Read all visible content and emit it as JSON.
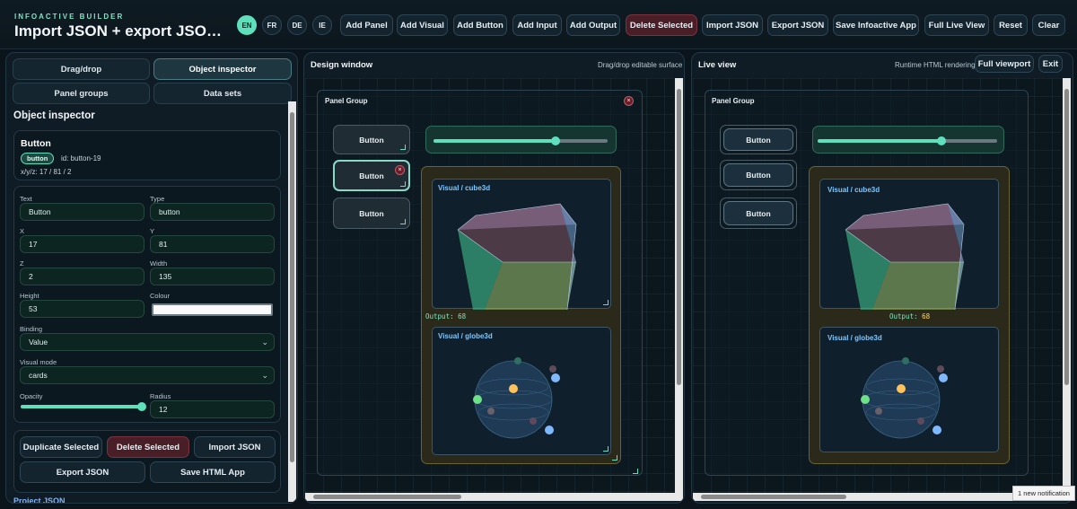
{
  "app": {
    "brand_small": "INFOACTIVE BUILDER",
    "title": "Import JSON + export JSON + save s..."
  },
  "languages": [
    "EN",
    "FR",
    "DE",
    "IE"
  ],
  "active_language": "EN",
  "toolbar": {
    "add_panel": "Add Panel",
    "add_visual": "Add Visual",
    "add_button": "Add Button",
    "add_input": "Add Input",
    "add_output": "Add Output",
    "delete_selected": "Delete Selected",
    "import_json": "Import JSON",
    "export_json": "Export JSON",
    "save_app": "Save Infoactive App",
    "full_live_view": "Full Live View",
    "reset": "Reset",
    "clear": "Clear"
  },
  "left": {
    "tabs": [
      "Drag/drop",
      "Object inspector",
      "Panel groups",
      "Data sets"
    ],
    "active_tab": "Object inspector",
    "section_title": "Object inspector",
    "selected": {
      "name": "Button",
      "type_badge": "button",
      "id_text": "id: button-19",
      "coords": "x/y/z: 17 / 81 / 2"
    },
    "fields": {
      "text_label": "Text",
      "text_value": "Button",
      "type_label": "Type",
      "type_value": "button",
      "x_label": "X",
      "x_value": "17",
      "y_label": "Y",
      "y_value": "81",
      "z_label": "Z",
      "z_value": "2",
      "width_label": "Width",
      "width_value": "135",
      "height_label": "Height",
      "height_value": "53",
      "colour_label": "Colour",
      "colour_value": "#ffffff",
      "binding_label": "Binding",
      "binding_value": "Value",
      "visual_mode_label": "Visual mode",
      "visual_mode_value": "cards",
      "opacity_label": "Opacity",
      "opacity_value": 1.0,
      "radius_label": "Radius",
      "radius_value": "12"
    },
    "actions": {
      "duplicate": "Duplicate Selected",
      "delete": "Delete Selected",
      "import": "Import JSON",
      "export": "Export JSON",
      "save_html": "Save HTML App"
    },
    "project_json_label": "Project JSON"
  },
  "design": {
    "title": "Design window",
    "subtitle": "Drag/drop editable surface",
    "group_title": "Panel Group",
    "buttons": [
      "Button",
      "Button",
      "Button"
    ],
    "slider_value": 0.74,
    "visual_cube_title": "Visual / cube3d",
    "visual_globe_title": "Visual / globe3d",
    "output_label": "Output:",
    "output_value": "68"
  },
  "live": {
    "title": "Live view",
    "subtitle": "Runtime HTML rendering",
    "full_viewport": "Full viewport",
    "exit": "Exit",
    "group_title": "Panel Group",
    "buttons": [
      "Button",
      "Button",
      "Button"
    ],
    "slider_value": 0.74,
    "visual_cube_title": "Visual / cube3d",
    "visual_globe_title": "Visual / globe3d",
    "output_label": "Output:",
    "output_value": "68"
  },
  "notification": "1 new notification",
  "colors": {
    "accent": "#5fe0bc",
    "danger": "#4a1e27",
    "background": "#0b141b"
  }
}
